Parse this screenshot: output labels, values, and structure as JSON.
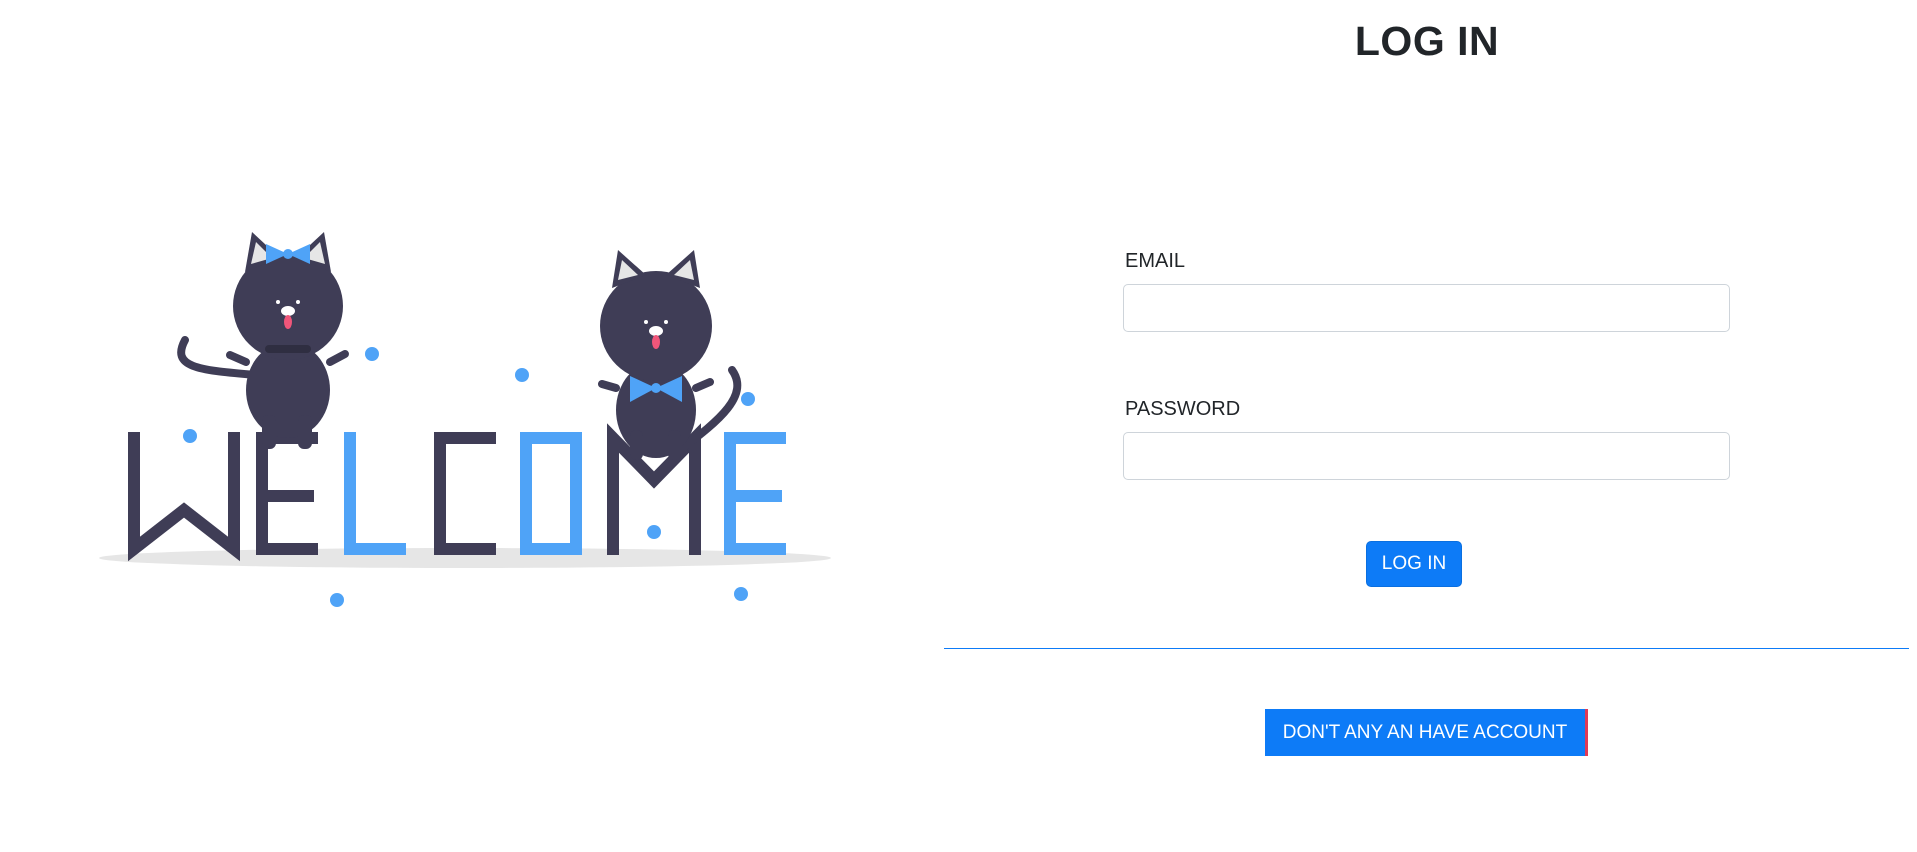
{
  "title": "LOG IN",
  "illustration": {
    "word": "WELCOME",
    "colors": {
      "dark": "#3f3d56",
      "accent": "#4fa3f7",
      "shadow": "#e6e6e6",
      "ear_inner": "#e6e6e6",
      "tongue": "#f0567a"
    }
  },
  "form": {
    "email_label": "EMAIL",
    "email_value": "",
    "password_label": "PASSWORD",
    "password_value": "",
    "submit_label": "LOG IN"
  },
  "signup": {
    "button_label": "DON'T ANY AN HAVE ACCOUNT"
  },
  "colors": {
    "primary": "#0d7bf7",
    "divider": "#0d7bf7",
    "text": "#212529",
    "input_border": "#ced4da"
  }
}
